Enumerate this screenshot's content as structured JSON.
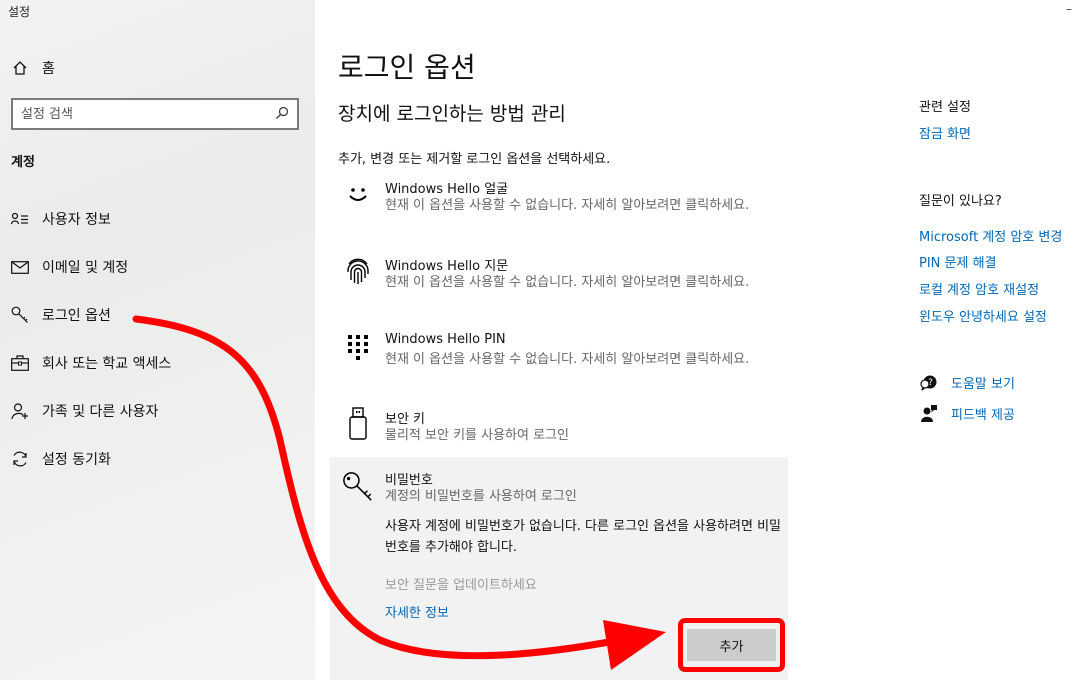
{
  "window": {
    "title": "설정",
    "close_glyph": "–"
  },
  "sidebar": {
    "home_label": "홈",
    "search_placeholder": "설정 검색",
    "section_label": "계정",
    "items": [
      {
        "label": "사용자 정보",
        "icon": "user-info-icon"
      },
      {
        "label": "이메일 및 계정",
        "icon": "mail-icon"
      },
      {
        "label": "로그인 옵션",
        "icon": "key-icon"
      },
      {
        "label": "회사 또는 학교 액세스",
        "icon": "briefcase-icon"
      },
      {
        "label": "가족 및 다른 사용자",
        "icon": "add-user-icon"
      },
      {
        "label": "설정 동기화",
        "icon": "sync-icon"
      }
    ]
  },
  "main": {
    "title": "로그인 옵션",
    "subtitle": "장치에 로그인하는 방법 관리",
    "description": "추가, 변경 또는 제거할 로그인 옵션을 선택하세요.",
    "options": [
      {
        "name": "Windows Hello 얼굴",
        "desc": "현재 이 옵션을 사용할 수 없습니다. 자세히 알아보려면 클릭하세요.",
        "icon": "face-icon"
      },
      {
        "name": "Windows Hello 지문",
        "desc": "현재 이 옵션을 사용할 수 없습니다. 자세히 알아보려면 클릭하세요.",
        "icon": "fingerprint-icon"
      },
      {
        "name": "Windows Hello PIN",
        "desc": "현재 이 옵션을 사용할 수 없습니다. 자세히 알아보려면 클릭하세요.",
        "icon": "pin-keypad-icon"
      },
      {
        "name": "보안 키",
        "desc": "물리적 보안 키를 사용하여 로그인",
        "icon": "usb-key-icon"
      },
      {
        "name": "비밀번호",
        "desc": "계정의 비밀번호를 사용하여 로그인",
        "icon": "password-key-icon"
      }
    ],
    "password_panel": {
      "message": "사용자 계정에 비밀번호가 없습니다. 다른 로그인 옵션을 사용하려면 비밀번호를 추가해야 합니다.",
      "security_questions": "보안 질문을 업데이트하세요",
      "more_info": "자세한 정보",
      "add_button": "추가"
    }
  },
  "right": {
    "related_heading": "관련 설정",
    "related_link": "잠금 화면",
    "questions_heading": "질문이 있나요?",
    "question_links": [
      "Microsoft 계정 암호 변경",
      "PIN 문제 해결",
      "로컬 계정 암호 재설정",
      "윈도우 안녕하세요 설정"
    ],
    "help_label": "도움말 보기",
    "feedback_label": "피드백 제공"
  },
  "colors": {
    "link": "#0067b8",
    "annotation": "#ff0000",
    "panel": "#f2f2f2",
    "button": "#cccccc"
  }
}
